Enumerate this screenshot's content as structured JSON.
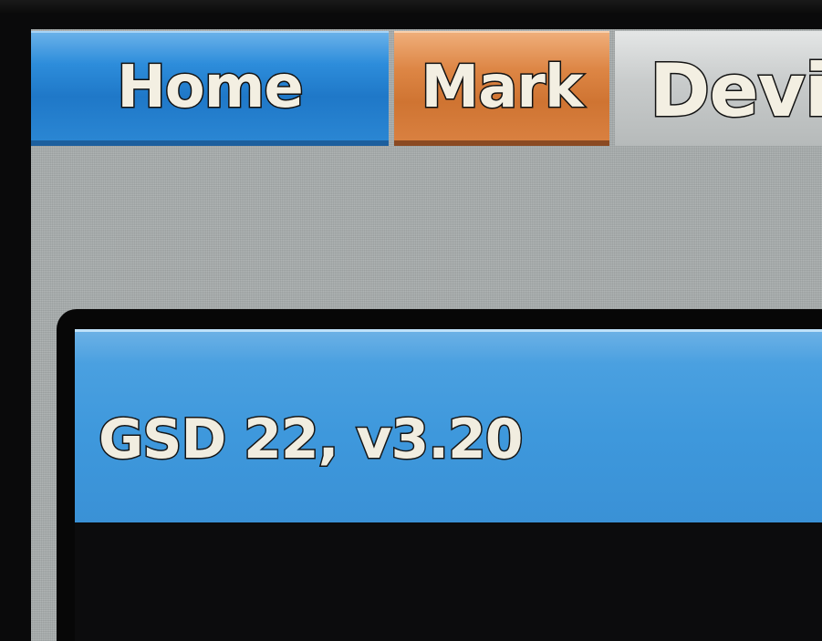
{
  "tabs": [
    {
      "label": "Home",
      "color": "#2d8ddb"
    },
    {
      "label": "Mark",
      "color": "#dd8645"
    },
    {
      "label": "Devi",
      "color": "#c8cbcb"
    }
  ],
  "window": {
    "title": "GSD 22, v3.20"
  },
  "colors": {
    "panel": "#a9aeae",
    "titlebar": "#3e98dc",
    "background": "#0a0a0b"
  }
}
